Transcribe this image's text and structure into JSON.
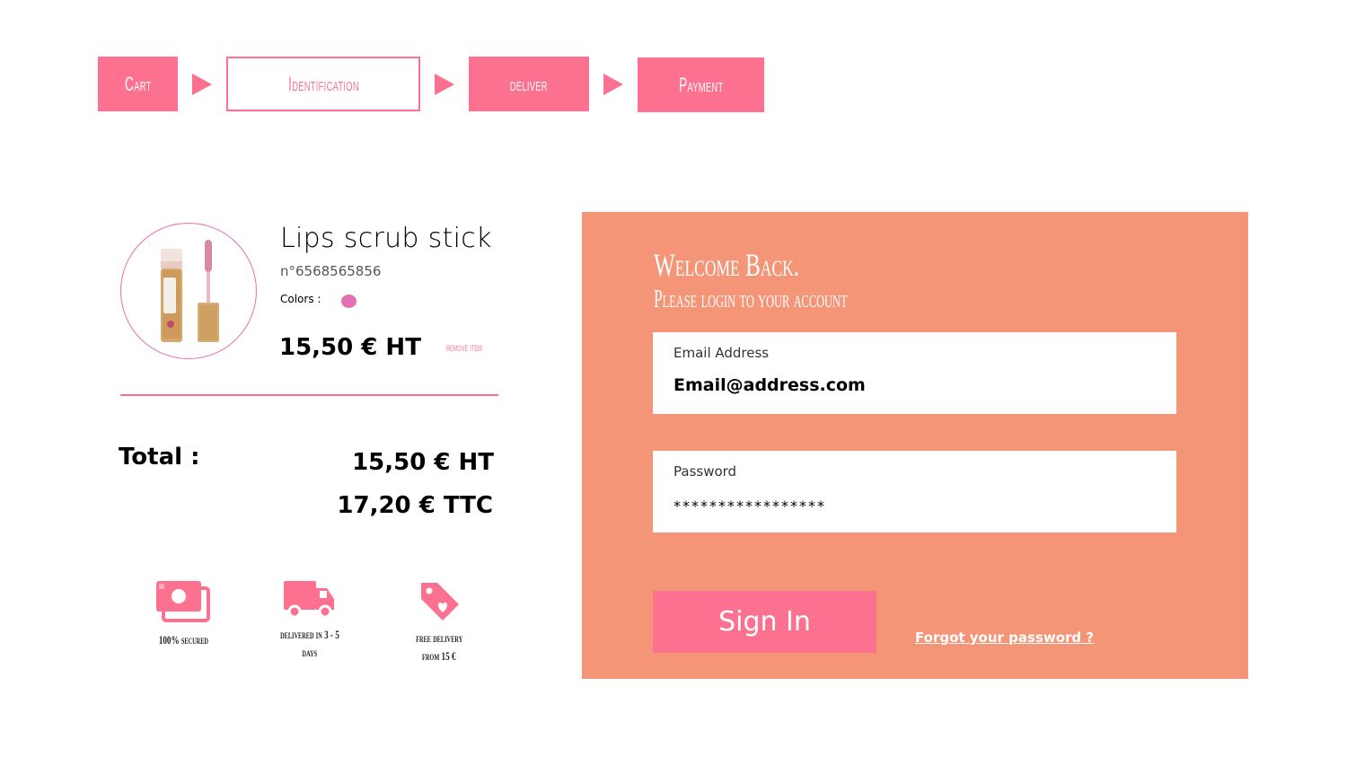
{
  "stepper": {
    "steps": [
      {
        "label": "Cart",
        "state": "filled"
      },
      {
        "label": "Identification",
        "state": "active"
      },
      {
        "label": "deliver",
        "state": "filled"
      },
      {
        "label": "Payment",
        "state": "filled"
      }
    ]
  },
  "product": {
    "name": "Lips scrub stick",
    "reference": "n°6568565856",
    "colors_label": "Colors :",
    "color_swatch": "#e46fb2",
    "price": "15,50 € HT",
    "remove_label": "remove item"
  },
  "totals": {
    "label": "Total :",
    "ht": "15,50 € HT",
    "ttc": "17,20 € TTC"
  },
  "features": [
    {
      "icon": "money-icon",
      "line1": "100% secured",
      "line2": ""
    },
    {
      "icon": "truck-icon",
      "line1": "delivered in 3 - 5",
      "line2": "days"
    },
    {
      "icon": "heart-tag-icon",
      "line1": "free delivery",
      "line2": "from 15 €"
    }
  ],
  "login": {
    "title": "Welcome Back.",
    "subtitle": "Please login to your account",
    "email_label": "Email Address",
    "email_value": "Email@address.com",
    "password_label": "Password",
    "password_value": "*****************",
    "signin_label": "Sign In",
    "forgot_label": "Forgot your password ?"
  },
  "colors": {
    "accent_pink": "#fc7190",
    "panel_salmon": "#f49577",
    "swatch": "#e46fb2"
  }
}
